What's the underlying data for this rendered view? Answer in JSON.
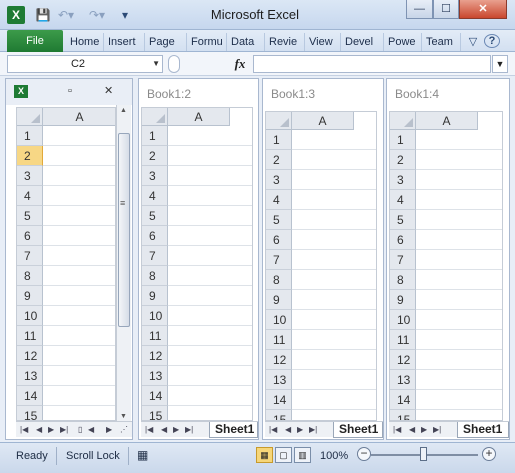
{
  "app": {
    "title": "Microsoft Excel",
    "icon_letter": "X",
    "qat": {
      "save_icon": "save-icon",
      "undo_icon": "undo-icon",
      "redo_icon": "redo-icon",
      "customize_icon": "chevron-down-icon"
    },
    "window_controls": {
      "minimize": "—",
      "maximize": "☐",
      "close": "✕"
    }
  },
  "ribbon": {
    "file_label": "File",
    "tabs": [
      "Home",
      "Insert",
      "Page",
      "Formu",
      "Data",
      "Revie",
      "View",
      "Devel",
      "Powe",
      "Team"
    ],
    "icons": {
      "help": "?",
      "collapse": "▽"
    }
  },
  "formula_bar": {
    "name_box": "C2",
    "fx": "fx",
    "formula": ""
  },
  "windows": [
    {
      "title": "",
      "col": "A",
      "rows": [
        "1",
        "2",
        "3",
        "4",
        "5",
        "6",
        "7",
        "8",
        "9",
        "10",
        "11",
        "12",
        "13",
        "14",
        "15"
      ],
      "selected_row": "2",
      "sheet": ""
    },
    {
      "title": "Book1:2",
      "col": "A",
      "rows": [
        "1",
        "2",
        "3",
        "4",
        "5",
        "6",
        "7",
        "8",
        "9",
        "10",
        "11",
        "12",
        "13",
        "14",
        "15"
      ],
      "sheet": "Sheet1"
    },
    {
      "title": "Book1:3",
      "col": "A",
      "rows": [
        "1",
        "2",
        "3",
        "4",
        "5",
        "6",
        "7",
        "8",
        "9",
        "10",
        "11",
        "12",
        "13",
        "14",
        "15"
      ],
      "sheet": "Sheet1"
    },
    {
      "title": "Book1:4",
      "col": "A",
      "rows": [
        "1",
        "2",
        "3",
        "4",
        "5",
        "6",
        "7",
        "8",
        "9",
        "10",
        "11",
        "12",
        "13",
        "14",
        "15"
      ],
      "sheet": "Sheet1"
    }
  ],
  "status": {
    "ready": "Ready",
    "scroll_lock": "Scroll Lock",
    "zoom": "100%",
    "zoom_minus": "−",
    "zoom_plus": "+",
    "zoom_level": 0.5
  }
}
